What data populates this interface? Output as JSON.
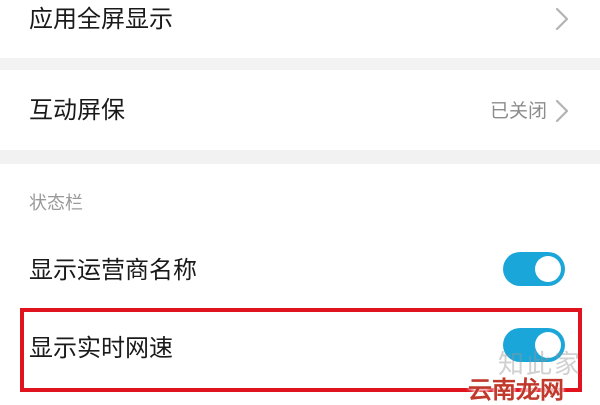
{
  "settings": {
    "fullscreen_display": {
      "label": "应用全屏显示"
    },
    "interactive_screensaver": {
      "label": "互动屏保",
      "value": "已关闭"
    },
    "status_bar_section": {
      "header": "状态栏"
    },
    "show_carrier_name": {
      "label": "显示运营商名称",
      "enabled": true
    },
    "show_network_speed": {
      "label": "显示实时网速",
      "enabled": true
    }
  },
  "watermark": {
    "faint_text": "知此家",
    "brand_text": "云南龙网"
  },
  "colors": {
    "toggle_on": "#1aa6d9",
    "highlight_border": "#e0141e",
    "separator": "#f2f2f2",
    "watermark_brand": "#c0392b"
  },
  "icons": {
    "chevron": "chevron-right-icon"
  }
}
